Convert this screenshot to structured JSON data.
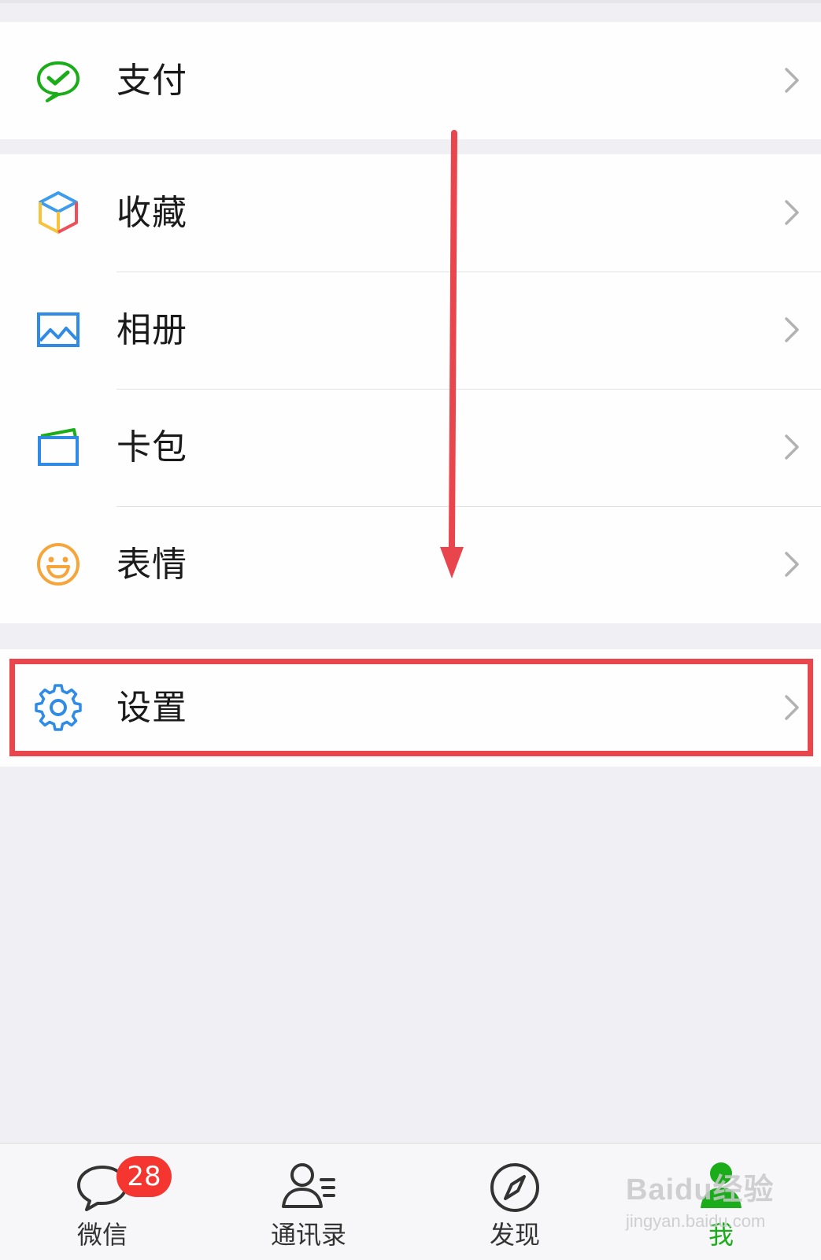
{
  "menu": {
    "pay": {
      "label": "支付"
    },
    "favorites": {
      "label": "收藏"
    },
    "album": {
      "label": "相册"
    },
    "cards": {
      "label": "卡包"
    },
    "stickers": {
      "label": "表情"
    },
    "settings": {
      "label": "设置"
    }
  },
  "tabbar": {
    "chats": {
      "label": "微信",
      "badge": "28",
      "icon": "chat-bubble-icon"
    },
    "contacts": {
      "label": "通讯录",
      "icon": "contacts-icon"
    },
    "discover": {
      "label": "发现",
      "icon": "compass-icon"
    },
    "me": {
      "label": "我",
      "icon": "person-icon",
      "active": true
    }
  },
  "watermark": {
    "main": "Baidu经验",
    "sub": "jingyan.baidu.com"
  },
  "colors": {
    "accent_green": "#1aad19",
    "annotation_red": "#e8454d",
    "badge_red": "#f43530",
    "background": "#efeff4"
  }
}
